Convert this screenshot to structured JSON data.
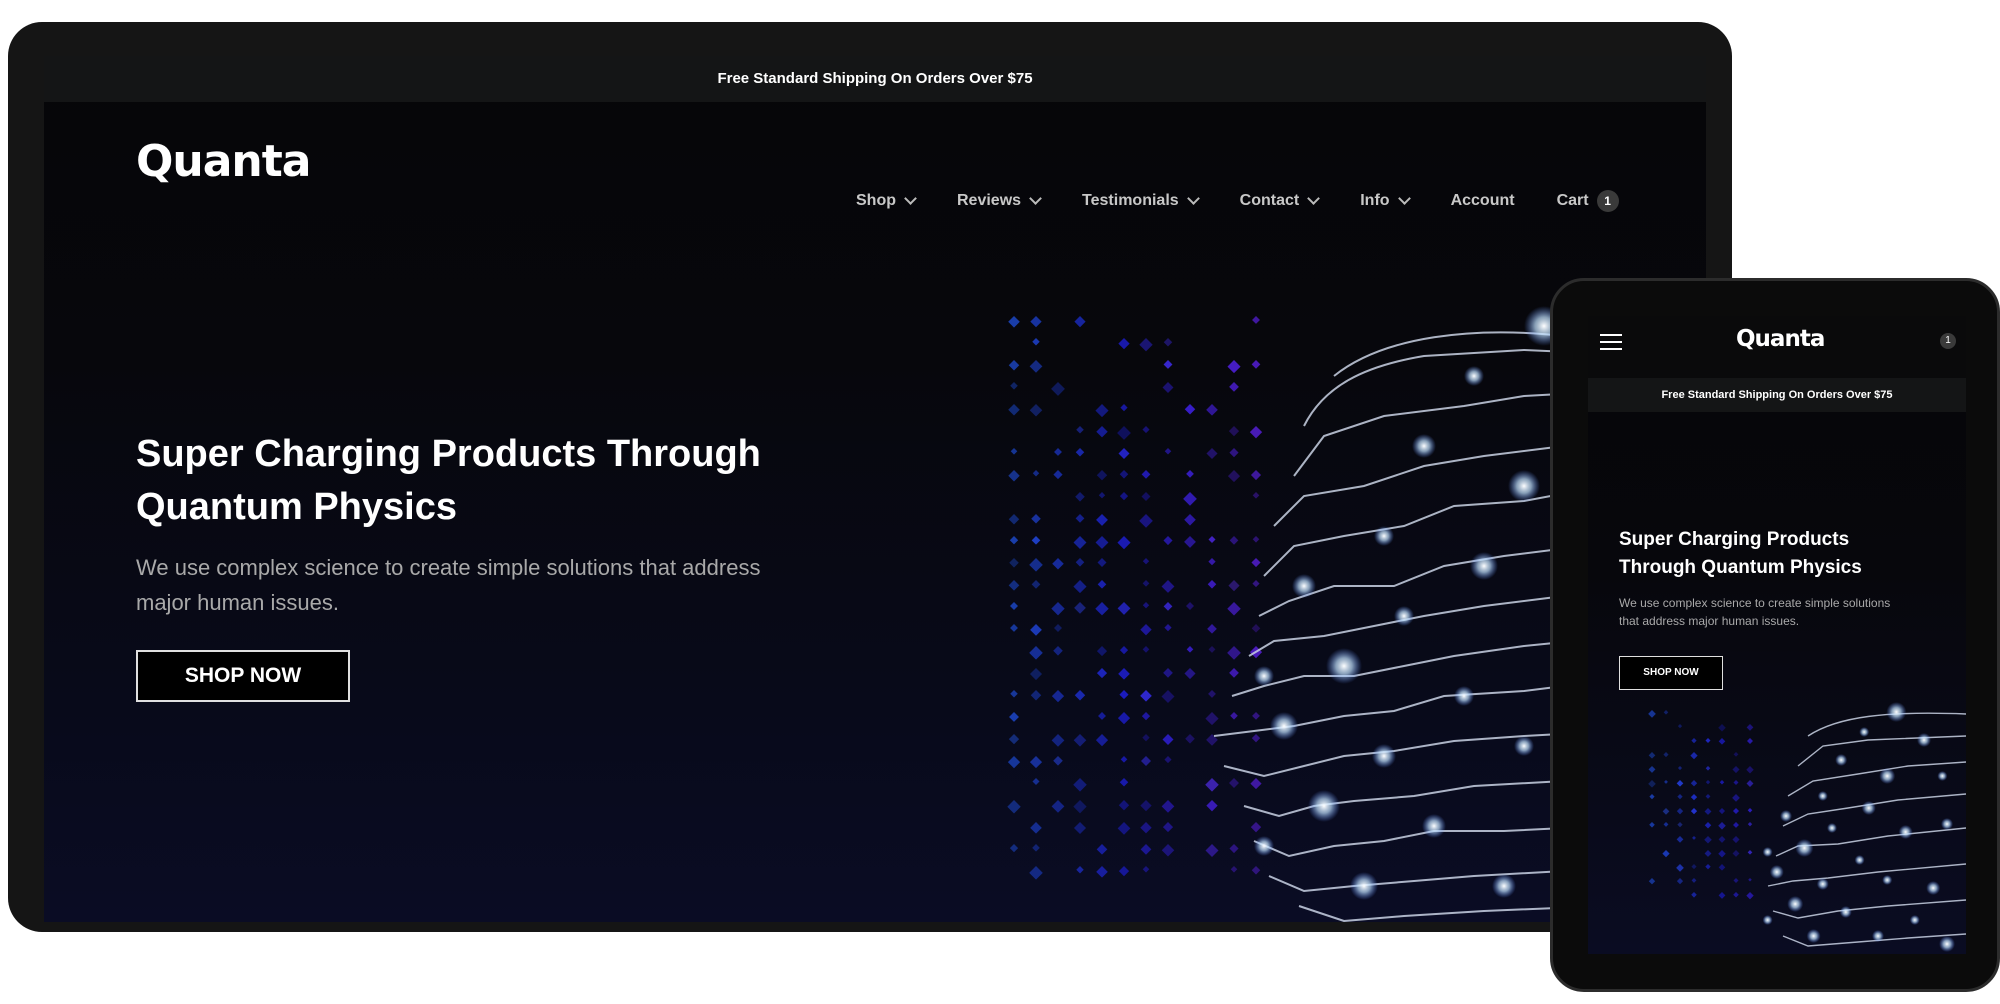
{
  "desktop": {
    "announcement": "Free Standard Shipping On Orders Over $75",
    "logo": "Quanta",
    "nav": [
      {
        "label": "Shop",
        "dropdown": true,
        "icon": "chevron-down-icon"
      },
      {
        "label": "Reviews",
        "dropdown": true,
        "icon": "chevron-down-icon"
      },
      {
        "label": "Testimonials",
        "dropdown": true,
        "icon": "chevron-down-icon"
      },
      {
        "label": "Contact",
        "dropdown": true,
        "icon": "chevron-down-icon"
      },
      {
        "label": "Info",
        "dropdown": true,
        "icon": "chevron-down-icon"
      },
      {
        "label": "Account",
        "dropdown": false
      },
      {
        "label": "Cart",
        "dropdown": false
      }
    ],
    "cart_count": "1",
    "hero": {
      "title": "Super Charging Products Through Quantum Physics",
      "subtitle": "We use complex science to create simple solutions that address major human issues.",
      "cta": "SHOP NOW"
    }
  },
  "tablet": {
    "logo": "Quanta",
    "menu_icon": "hamburger-icon",
    "cart_count": "1",
    "announcement": "Free Standard Shipping On Orders Over $75",
    "hero": {
      "title": "Super Charging Products Through Quantum Physics",
      "subtitle": "We use complex science to create simple solutions that address major human issues.",
      "cta": "SHOP NOW"
    }
  },
  "colors": {
    "background": "#060608",
    "hero_gradient_end": "#0a0c24",
    "text_primary": "#ffffff",
    "text_muted": "#a9a9a9",
    "announcement_bar": "#141516",
    "dot_pattern": "#1f3fbf",
    "circuit_lines": "#d4dbe8",
    "glow": "#cfe4ff"
  }
}
